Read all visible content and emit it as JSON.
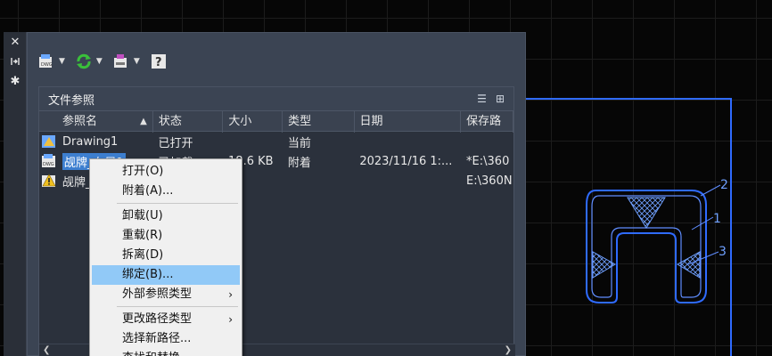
{
  "palette": {
    "title": "文件参照",
    "side_buttons": [
      "close-icon",
      "pin-icon",
      "settings-icon"
    ],
    "toolbar": [
      "attach-dwg",
      "refresh",
      "change-path",
      "help"
    ]
  },
  "table": {
    "columns": [
      "参照名",
      "状态",
      "大小",
      "类型",
      "日期",
      "保存路"
    ],
    "rows": [
      {
        "name": "Drawing1",
        "status": "已打开",
        "size": "",
        "type": "当前",
        "date": "",
        "path": ""
      },
      {
        "name": "觇牌_布局1",
        "status": "已加载",
        "size": "18.6 KB",
        "type": "附着",
        "date": "2023/11/16 1:...",
        "path": "*E:\\360"
      },
      {
        "name": "觇牌_",
        "status": "",
        "size": "",
        "type": "",
        "date": "",
        "path": "E:\\360N"
      }
    ]
  },
  "context_menu": {
    "items": [
      {
        "label": "打开(O)"
      },
      {
        "label": "附着(A)..."
      },
      {
        "label": "卸载(U)"
      },
      {
        "label": "重载(R)"
      },
      {
        "label": "拆离(D)"
      },
      {
        "label": "绑定(B)..."
      },
      {
        "label": "外部参照类型"
      },
      {
        "label": "更改路径类型"
      },
      {
        "label": "选择新路径..."
      },
      {
        "label": "查找和替换..."
      }
    ]
  },
  "drawing": {
    "labels": [
      "2",
      "1",
      "3"
    ],
    "accent": "#2f6bff"
  }
}
